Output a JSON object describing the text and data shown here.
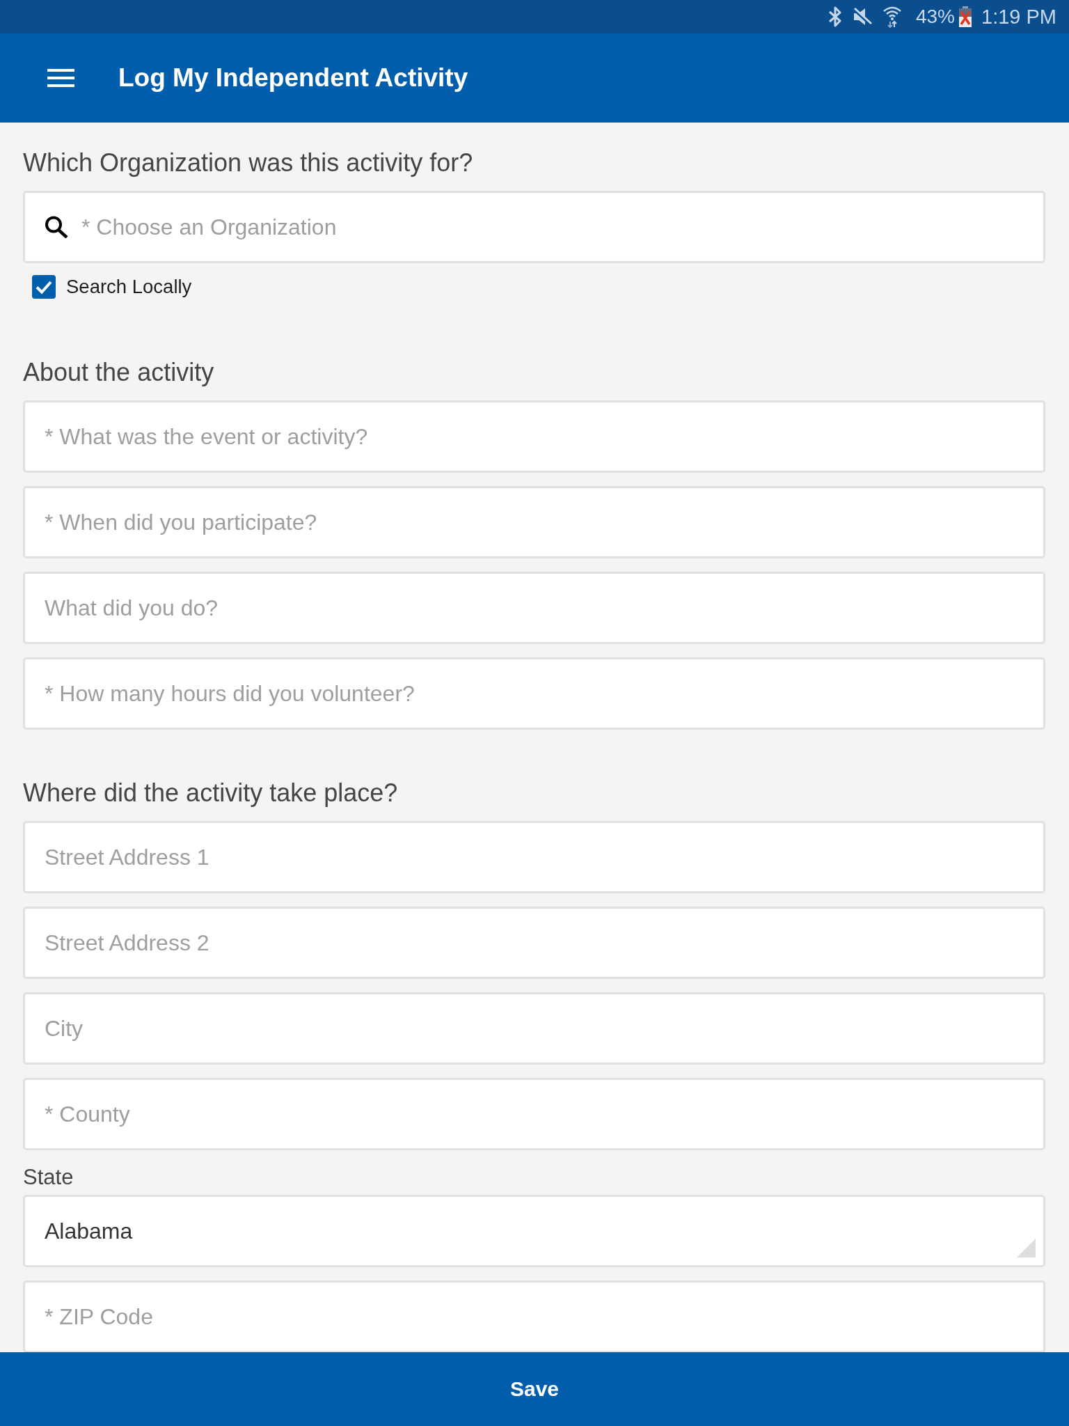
{
  "status_bar": {
    "battery": "43%",
    "time": "1:19 PM"
  },
  "app_bar": {
    "title": "Log My Independent Activity"
  },
  "sections": [
    {
      "heading": "Which Organization was this activity for?",
      "fields": [
        {
          "kind": "search",
          "placeholder": "* Choose an Organization"
        },
        {
          "kind": "checkbox",
          "label": "Search Locally",
          "checked": true
        }
      ]
    },
    {
      "heading": "About the activity",
      "fields": [
        {
          "kind": "text",
          "placeholder": "* What was the event or activity?"
        },
        {
          "kind": "text",
          "placeholder": "* When did you participate?"
        },
        {
          "kind": "text",
          "placeholder": "What did you do?"
        },
        {
          "kind": "text",
          "placeholder": "* How many hours did you volunteer?"
        }
      ]
    },
    {
      "heading": "Where did the activity take place?",
      "fields": [
        {
          "kind": "text",
          "placeholder": "Street Address 1"
        },
        {
          "kind": "text",
          "placeholder": "Street Address 2"
        },
        {
          "kind": "text",
          "placeholder": "City"
        },
        {
          "kind": "text",
          "placeholder": "* County"
        },
        {
          "kind": "select",
          "label": "State",
          "value": "Alabama"
        },
        {
          "kind": "text",
          "placeholder": "* ZIP Code"
        }
      ]
    }
  ],
  "save_button": {
    "label": "Save"
  }
}
